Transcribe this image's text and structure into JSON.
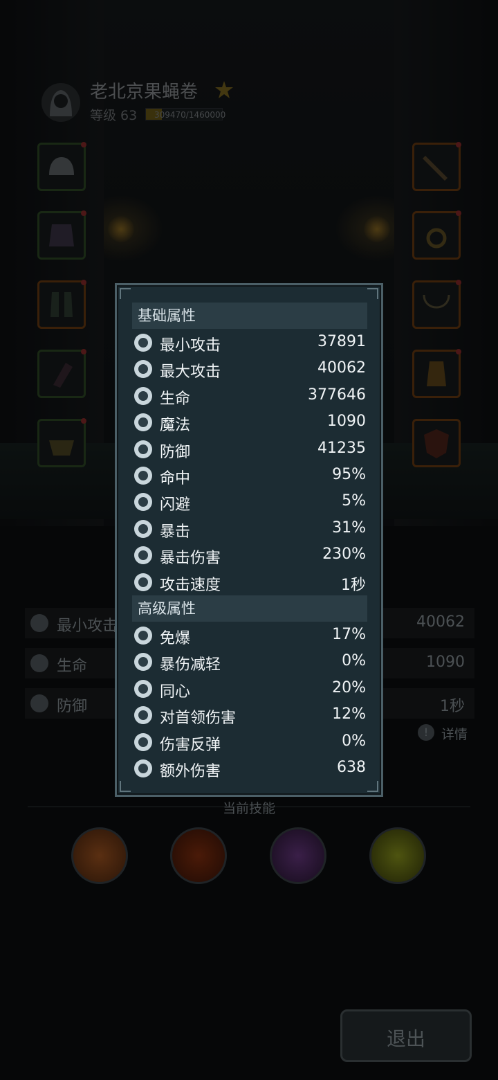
{
  "player": {
    "name": "老北京果蝇卷",
    "level_label": "等级 63",
    "xp_text": "309470/1460000",
    "xp_progress": 0.212
  },
  "background_stats": {
    "left": [
      "最小攻击",
      "生命",
      "防御"
    ],
    "right": [
      "40062",
      "1090",
      "1秒"
    ],
    "details_label": "详情"
  },
  "skills": {
    "title": "当前技能",
    "items": [
      {
        "icon": "explosion-skill-icon",
        "color": "#c4571a"
      },
      {
        "icon": "fire-vortex-skill-icon",
        "color": "#8e2c0c"
      },
      {
        "icon": "crystal-shard-skill-icon",
        "color": "#5a2d73"
      },
      {
        "icon": "bubble-skill-icon",
        "color": "#8b9618"
      }
    ]
  },
  "exit_label": "退出",
  "modal": {
    "basic_title": "基础属性",
    "basic": [
      {
        "label": "最小攻击",
        "value": "37891",
        "icon": "sword-icon"
      },
      {
        "label": "最大攻击",
        "value": "40062",
        "icon": "sword-icon"
      },
      {
        "label": "生命",
        "value": "377646",
        "icon": "heart-icon"
      },
      {
        "label": "魔法",
        "value": "1090",
        "icon": "magic-swirl-icon"
      },
      {
        "label": "防御",
        "value": "41235",
        "icon": "shield-icon"
      },
      {
        "label": "命中",
        "value": "95%",
        "icon": "target-icon"
      },
      {
        "label": "闪避",
        "value": "5%",
        "icon": "dodge-icon"
      },
      {
        "label": "暴击",
        "value": "31%",
        "icon": "critical-icon"
      },
      {
        "label": "暴击伤害",
        "value": "230%",
        "icon": "burst-icon"
      },
      {
        "label": "攻击速度",
        "value": "1秒",
        "icon": "speed-icon"
      }
    ],
    "advanced_title": "高级属性",
    "advanced": [
      {
        "label": "免爆",
        "value": "17%",
        "icon": "skull-icon"
      },
      {
        "label": "暴伤减轻",
        "value": "0%",
        "icon": "reduce-icon"
      },
      {
        "label": "同心",
        "value": "20%",
        "icon": "scroll-icon"
      },
      {
        "label": "对首领伤害",
        "value": "12%",
        "icon": "boss-icon"
      },
      {
        "label": "伤害反弹",
        "value": "0%",
        "icon": "reflect-icon"
      },
      {
        "label": "额外伤害",
        "value": "638",
        "icon": "extra-damage-icon"
      }
    ]
  }
}
